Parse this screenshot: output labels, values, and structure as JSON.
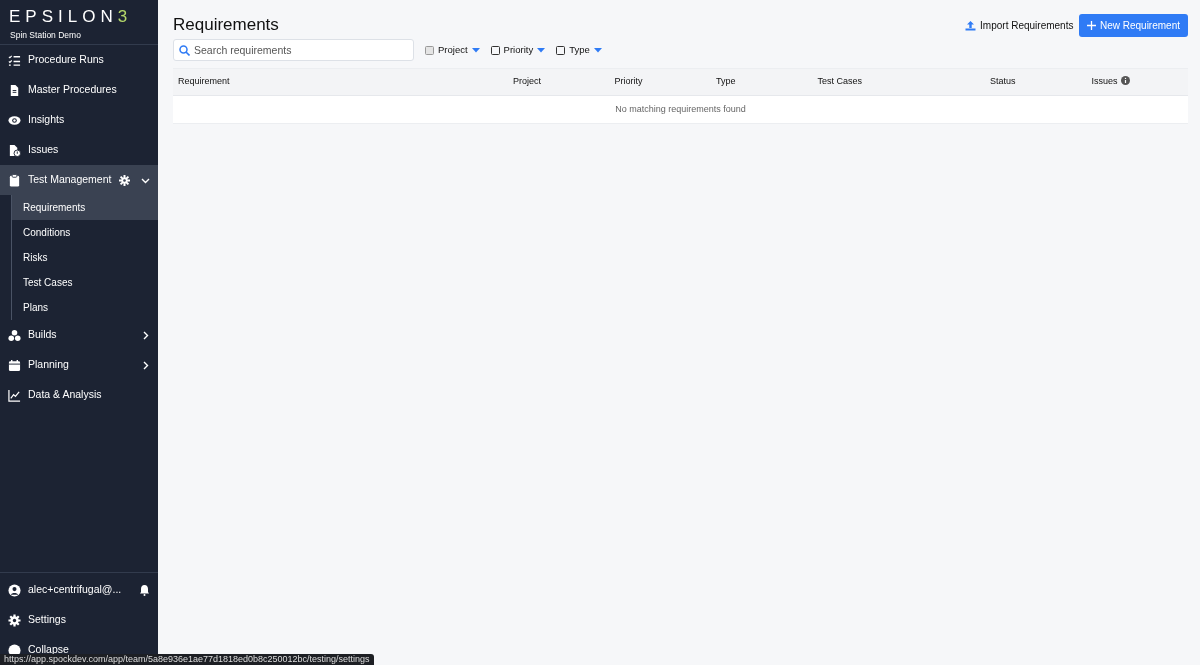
{
  "sidebar": {
    "logo": "EPSILON3",
    "workspace": "Spin Station Demo",
    "items": [
      {
        "label": "Procedure Runs",
        "selected": false
      },
      {
        "label": "Master Procedures",
        "selected": false
      },
      {
        "label": "Insights",
        "selected": false
      },
      {
        "label": "Issues",
        "selected": false
      },
      {
        "label": "Test Management",
        "selected": true,
        "expanded": true,
        "children": [
          {
            "label": "Requirements",
            "selected": true
          },
          {
            "label": "Conditions",
            "selected": false
          },
          {
            "label": "Risks",
            "selected": false
          },
          {
            "label": "Test Cases",
            "selected": false
          },
          {
            "label": "Plans",
            "selected": false
          }
        ]
      },
      {
        "label": "Builds",
        "selected": false,
        "expanded": false
      },
      {
        "label": "Planning",
        "selected": false,
        "expanded": false
      },
      {
        "label": "Data & Analysis",
        "selected": false
      }
    ],
    "footer": [
      {
        "label": "alec+centrifugal@..."
      },
      {
        "label": "Settings"
      },
      {
        "label": "Collapse"
      }
    ]
  },
  "page": {
    "title": "Requirements",
    "import_button": "Import Requirements",
    "new_button": "New Requirement"
  },
  "search": {
    "placeholder": "Search requirements"
  },
  "filters": [
    {
      "label": "Project",
      "checked": false,
      "disabled": true
    },
    {
      "label": "Priority",
      "checked": false,
      "disabled": false
    },
    {
      "label": "Type",
      "checked": false,
      "disabled": false
    }
  ],
  "table": {
    "columns": [
      "Requirement",
      "Project",
      "Priority",
      "Type",
      "Test Cases",
      "Status",
      "Issues"
    ],
    "empty_message": "No matching requirements found"
  },
  "status_bar": {
    "url": "https://app.spockdev.com/app/team/5a8e936e1ae77d1818ed0b8c250012bc/testing/settings"
  }
}
